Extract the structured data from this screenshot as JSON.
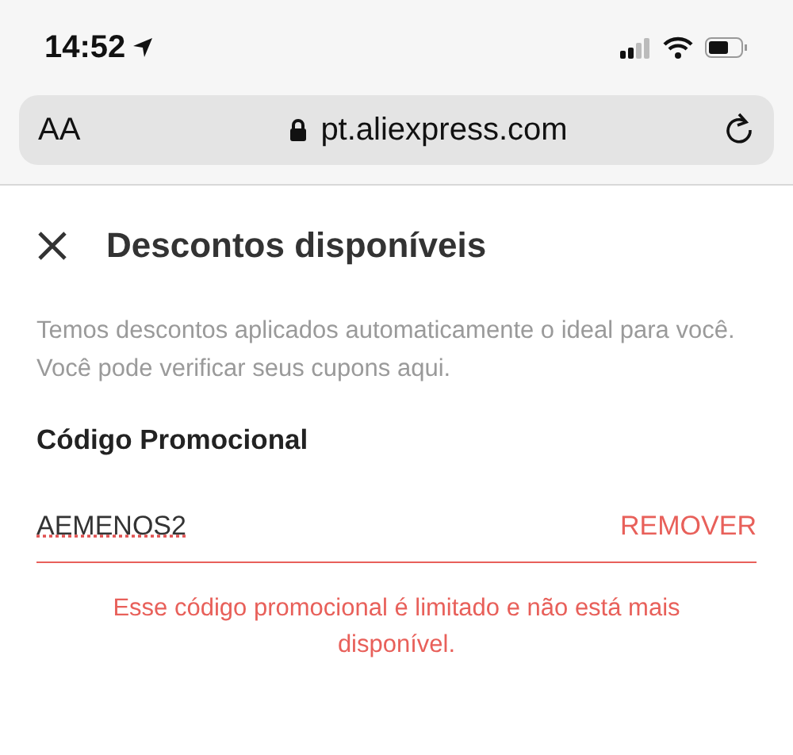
{
  "status_bar": {
    "time": "14:52"
  },
  "browser": {
    "text_size_button": "AA",
    "url": "pt.aliexpress.com"
  },
  "panel": {
    "title": "Descontos disponíveis",
    "description": "Temos descontos aplicados automaticamente o ideal para você. Você pode verificar seus cupons aqui.",
    "section_label": "Código Promocional",
    "promo_field": {
      "value": "AEMENOS2",
      "action": "REMOVER",
      "invalid": true
    },
    "error_message": "Esse código promocional é limitado e não está mais disponível."
  }
}
